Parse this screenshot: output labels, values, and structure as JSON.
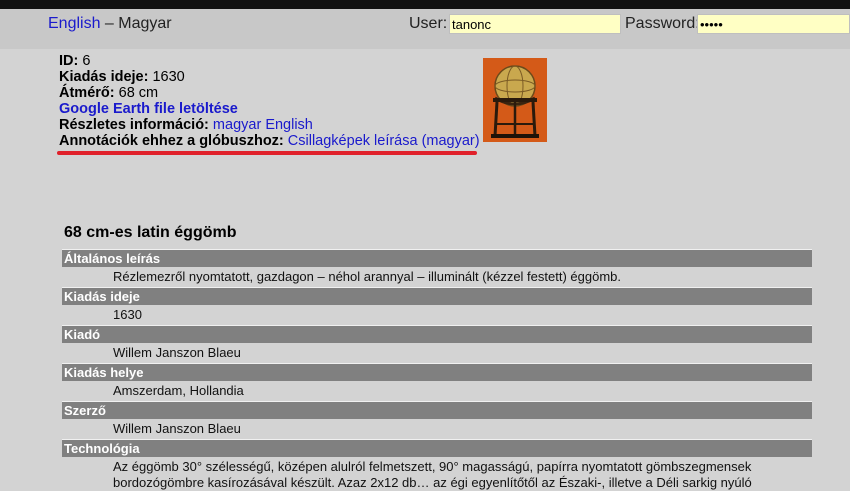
{
  "header": {
    "lang_english": "English",
    "lang_sep": " – ",
    "lang_magyar": "Magyar",
    "user_label": "User:",
    "user_value": "tanonc",
    "password_label": "Password:",
    "password_value": "*****"
  },
  "info": {
    "id_label": "ID:",
    "id_value": "6",
    "year_label": "Kiadás ideje:",
    "year_value": "1630",
    "diameter_label": "Átmérő:",
    "diameter_value": "68 cm",
    "google_earth_link": "Google Earth file letöltése",
    "details_label": "Részletes információ:",
    "details_link_magyar": "magyar",
    "details_link_english": "English",
    "annotations_label": "Annotációk ehhez a glóbuszhoz:",
    "annotations_link": "Csillagképek leírása (magyar)"
  },
  "title": "68 cm-es latin éggömb",
  "sections": [
    {
      "head": "Általános leírás",
      "body": "Rézlemezről nyomtatott, gazdagon – néhol arannyal – illuminált (kézzel festett) éggömb."
    },
    {
      "head": "Kiadás ideje",
      "body": "1630"
    },
    {
      "head": "Kiadó",
      "body": "Willem Janszon Blaeu"
    },
    {
      "head": "Kiadás helye",
      "body": "Amszerdam, Hollandia"
    },
    {
      "head": "Szerző",
      "body": "Willem Janszon Blaeu"
    },
    {
      "head": "Technológia",
      "body": "Az éggömb 30° szélességű, középen alulról felmetszett, 90° magasságú, papírra nyomtatott gömbszegmensek bordozógömbre kasírozásával készült. Azaz 2x12 db… az égi egyenlítőtől az Északi-, illetve a Déli sarkig nyúló"
    }
  ]
}
